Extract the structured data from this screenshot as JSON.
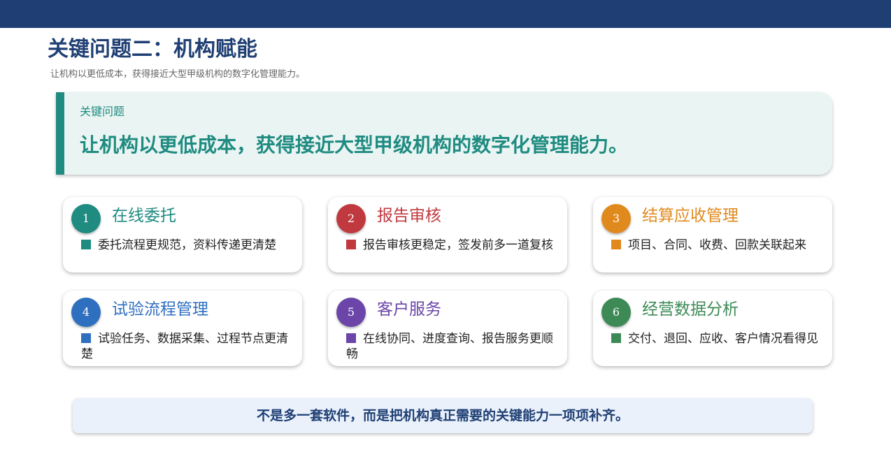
{
  "page": {
    "title": "关键问题二：机构赋能",
    "subtitle": "让机构以更低成本，获得接近大型甲级机构的数字化管理能力。"
  },
  "callout": {
    "label": "关键问题",
    "text": "让机构以更低成本，获得接近大型甲级机构的数字化管理能力。"
  },
  "cards": [
    {
      "number": "1",
      "title": "在线委托",
      "desc": "委托流程更规范，资料传递更清楚",
      "color": "#1f8b81"
    },
    {
      "number": "2",
      "title": "报告审核",
      "desc": "报告审核更稳定，签发前多一道复核",
      "color": "#c0393f"
    },
    {
      "number": "3",
      "title": "结算应收管理",
      "desc": "项目、合同、收费、回款关联起来",
      "color": "#e08a1e"
    },
    {
      "number": "4",
      "title": "试验流程管理",
      "desc": "试验任务、数据采集、过程节点更清楚",
      "color": "#2f6fbf"
    },
    {
      "number": "5",
      "title": "客户服务",
      "desc": "在线协同、进度查询、报告服务更顺畅",
      "color": "#6b46a8"
    },
    {
      "number": "6",
      "title": "经营数据分析",
      "desc": "交付、退回、应收、客户情况看得见",
      "color": "#3d8a57"
    }
  ],
  "footer": {
    "text": "不是多一套软件，而是把机构真正需要的关键能力一项项补齐。"
  }
}
